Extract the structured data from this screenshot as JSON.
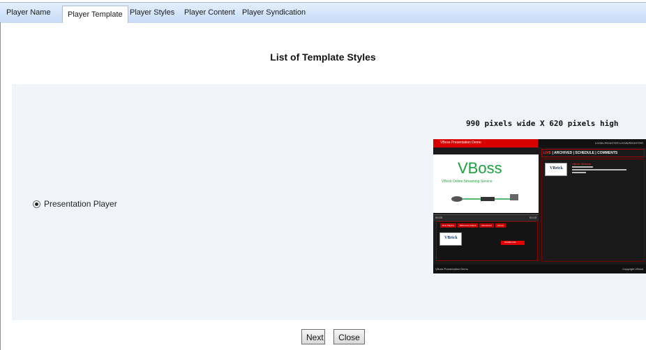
{
  "tabs": [
    {
      "label": "Player Name",
      "active": false
    },
    {
      "label": "Player Template",
      "active": true
    },
    {
      "label": "Player Styles",
      "active": false
    },
    {
      "label": "Player Content",
      "active": false
    },
    {
      "label": "Player Syndication",
      "active": false
    }
  ],
  "page_title": "List of Template Styles",
  "template_option": {
    "label": "Presentation Player",
    "selected": true,
    "dimensions": "990 pixels wide X 620 pixels high"
  },
  "preview": {
    "header_title": "VBoss Presentation Demo",
    "header_links": "LOGIN   REGISTER   LOGIN/REGISTER",
    "brand": "VBoss",
    "brand_subtitle": "VBrick Online Streaming Service",
    "nav": {
      "live": "LIVE",
      "rest": " | ARCHIVED | SCHEDULE | COMMENTS"
    },
    "mini_tabs": [
      "Now Playing",
      "Reference Videos",
      "Resources",
      "Survey"
    ],
    "logo": "VBrick",
    "red_button": "SHARE URL",
    "item_title": "VBrick Webinar",
    "controls_left": "00:20",
    "controls_right": "01:10",
    "footer_left": "VBoss Presentation Demo",
    "footer_right": "Copyright VBrick"
  },
  "buttons": {
    "next": "Next",
    "close": "Close"
  },
  "colors": {
    "accent_red": "#d90000",
    "brand_green": "#19a33b",
    "panel_bg": "#f1f4f8",
    "tab_bg": "#c7dbf7"
  }
}
